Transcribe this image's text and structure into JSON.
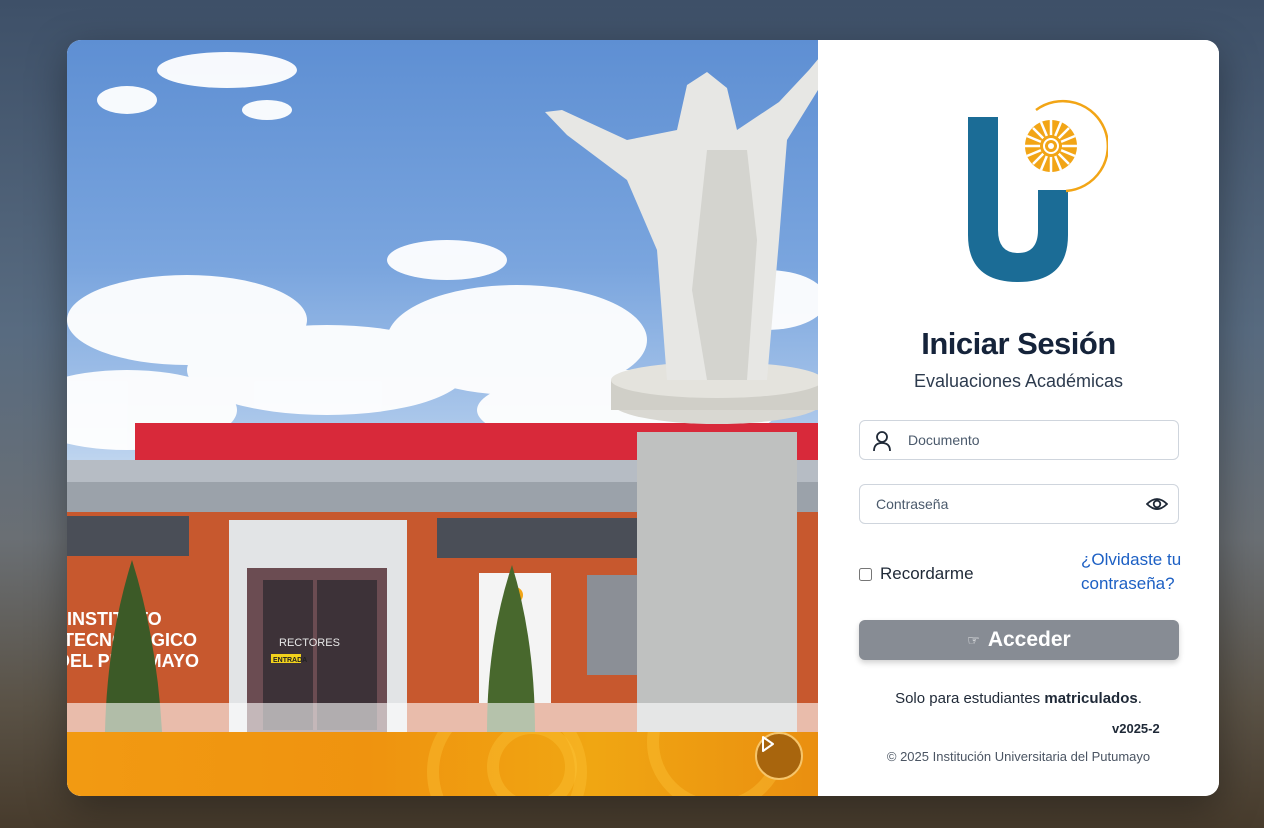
{
  "login": {
    "title": "Iniciar Sesión",
    "subtitle": "Evaluaciones Académicas",
    "document_placeholder": "Documento",
    "password_placeholder": "Contraseña",
    "remember_label": "Recordarme",
    "forgot_link": "¿Olvidaste tu contraseña?",
    "submit_label": "Acceder",
    "submit_icon": "hand-pointing-icon",
    "notice_prefix": "Solo para estudiantes ",
    "notice_bold": "matriculados",
    "notice_suffix": ".",
    "version": "v2025-2",
    "copyright": "© 2025 Institución Universitaria del Putumayo"
  },
  "campus_photo": {
    "building_sign_lines": [
      "INSTITUTO",
      "TECNOLÓGICO",
      "DEL PUTUMAYO"
    ],
    "door_sign": "RECTORES",
    "entrance_sign": "ENTRADA"
  },
  "colors": {
    "brand_blue": "#1b6c96",
    "brand_orange": "#f2a516",
    "button_bg": "#878c94",
    "link": "#1d60c4",
    "banner_orange": "#f29a12"
  }
}
